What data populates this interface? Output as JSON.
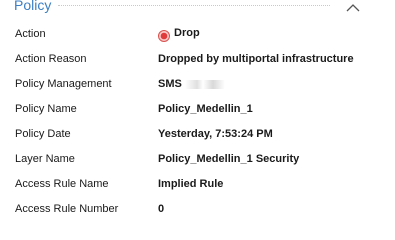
{
  "section": {
    "title": "Policy",
    "collapse_icon": "chevron-up-icon"
  },
  "properties": [
    {
      "label": "Action",
      "value": "Drop",
      "icon": "drop-icon",
      "icon_color": "#e03a3a"
    },
    {
      "label": "Action Reason",
      "value": "Dropped by multiportal infrastructure"
    },
    {
      "label": "Policy Management",
      "value": "SMS"
    },
    {
      "label": "Policy Name",
      "value": "Policy_Medellin_1"
    },
    {
      "label": "Policy Date",
      "value": "Yesterday, 7:53:24 PM"
    },
    {
      "label": "Layer Name",
      "value": "Policy_Medellin_1 Security"
    },
    {
      "label": "Access Rule Name",
      "value": "Implied Rule"
    },
    {
      "label": "Access Rule Number",
      "value": "0"
    }
  ]
}
